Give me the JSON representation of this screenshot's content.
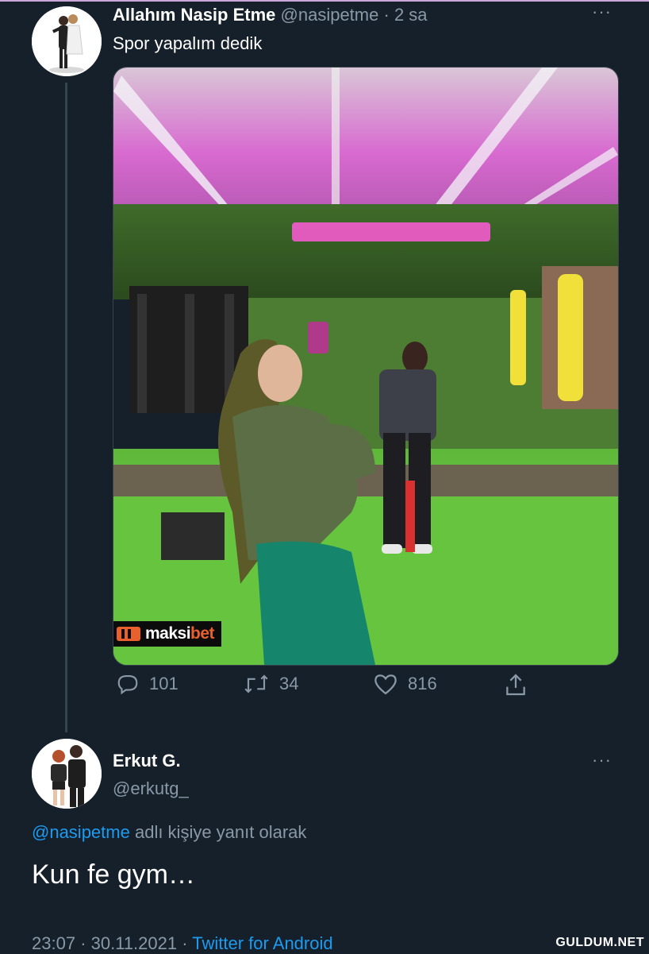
{
  "tweet1": {
    "display_name": "Allahım Nasip Etme",
    "handle": "@nasipetme",
    "separator": "·",
    "time": "2 sa",
    "text": "Spor yapalım dedik",
    "more": "···",
    "media_watermark": {
      "prefix": "maksi",
      "suffix": "bet"
    },
    "actions": {
      "replies": "101",
      "retweets": "34",
      "likes": "816"
    }
  },
  "tweet2": {
    "display_name": "Erkut G.",
    "handle": "@erkutg_",
    "more": "···",
    "reply_to_handle": "@nasipetme",
    "reply_to_suffix": "adlı kişiye yanıt olarak",
    "text": "Kun fe gym…",
    "time": "23:07",
    "date": "30.11.2021",
    "separator": "·",
    "source": "Twitter for Android"
  },
  "site_watermark": "GULDUM.NET",
  "colors": {
    "background": "#15202b",
    "link": "#1d9bf0",
    "muted": "#8b98a5"
  },
  "icons": [
    "reply-icon",
    "retweet-icon",
    "like-icon",
    "share-icon",
    "more-icon"
  ]
}
